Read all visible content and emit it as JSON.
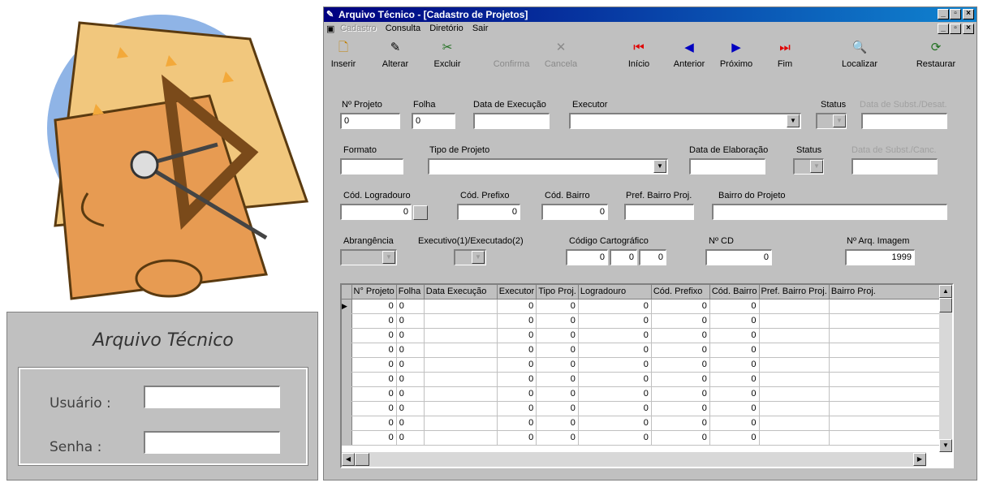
{
  "login": {
    "title": "Arquivo Técnico",
    "user_label": "Usuário :",
    "password_label": "Senha :",
    "user_value": "",
    "password_value": ""
  },
  "window": {
    "title": "Arquivo Técnico - [Cadastro de Projetos]",
    "controls": [
      "_",
      "▫",
      "×"
    ]
  },
  "menu": {
    "cadastro": "Cadastro",
    "consulta": "Consulta",
    "diretorio": "Diretório",
    "sair": "Sair"
  },
  "toolbar": {
    "inserir": "Inserir",
    "alterar": "Alterar",
    "excluir": "Excluir",
    "confirma": "Confirma",
    "cancela": "Cancela",
    "inicio": "Início",
    "anterior": "Anterior",
    "proximo": "Próximo",
    "fim": "Fim",
    "localizar": "Localizar",
    "restaurar": "Restaurar"
  },
  "form": {
    "n_projeto_label": "Nº Projeto",
    "n_projeto_value": "0",
    "folha_label": "Folha",
    "folha_value": "0",
    "data_execucao_label": "Data de Execução",
    "data_execucao_value": "",
    "executor_label": "Executor",
    "executor_value": "",
    "status1_label": "Status",
    "data_subst_desat_label": "Data de Subst./Desat.",
    "formato_label": "Formato",
    "formato_value": "",
    "tipo_projeto_label": "Tipo de Projeto",
    "tipo_projeto_value": "",
    "data_elaboracao_label": "Data de Elaboração",
    "data_elaboracao_value": "",
    "status2_label": "Status",
    "data_subst_canc_label": "Data de Subst./Canc.",
    "cod_logradouro_label": "Cód. Logradouro",
    "cod_logradouro_value": "0",
    "cod_prefixo_label": "Cód. Prefixo",
    "cod_prefixo_value": "0",
    "cod_bairro_label": "Cód. Bairro",
    "cod_bairro_value": "0",
    "pref_bairro_label": "Pref. Bairro Proj.",
    "pref_bairro_value": "",
    "bairro_projeto_label": "Bairro do Projeto",
    "bairro_projeto_value": "",
    "abrangencia_label": "Abrangência",
    "executivo_label": "Executivo(1)/Executado(2)",
    "codigo_cartografico_label": "Código Cartográfico",
    "cart1_value": "0",
    "cart2_value": "0",
    "cart3_value": "0",
    "n_cd_label": "Nº CD",
    "n_cd_value": "0",
    "n_arq_imagem_label": "Nº Arq. Imagem",
    "n_arq_imagem_value": "1999"
  },
  "grid": {
    "columns": [
      "N° Projeto",
      "Folha",
      "Data Execução",
      "Executor",
      "Tipo Proj.",
      "Logradouro",
      "Cód. Prefixo",
      "Cód. Bairro",
      "Pref. Bairro Proj.",
      "Bairro Proj."
    ],
    "rows": [
      [
        "0",
        "0",
        "",
        "0",
        "0",
        "0",
        "0",
        "0",
        "",
        ""
      ],
      [
        "0",
        "0",
        "",
        "0",
        "0",
        "0",
        "0",
        "0",
        "",
        ""
      ],
      [
        "0",
        "0",
        "",
        "0",
        "0",
        "0",
        "0",
        "0",
        "",
        ""
      ],
      [
        "0",
        "0",
        "",
        "0",
        "0",
        "0",
        "0",
        "0",
        "",
        ""
      ],
      [
        "0",
        "0",
        "",
        "0",
        "0",
        "0",
        "0",
        "0",
        "",
        ""
      ],
      [
        "0",
        "0",
        "",
        "0",
        "0",
        "0",
        "0",
        "0",
        "",
        ""
      ],
      [
        "0",
        "0",
        "",
        "0",
        "0",
        "0",
        "0",
        "0",
        "",
        ""
      ],
      [
        "0",
        "0",
        "",
        "0",
        "0",
        "0",
        "0",
        "0",
        "",
        ""
      ],
      [
        "0",
        "0",
        "",
        "0",
        "0",
        "0",
        "0",
        "0",
        "",
        ""
      ],
      [
        "0",
        "0",
        "",
        "0",
        "0",
        "0",
        "0",
        "0",
        "",
        ""
      ]
    ]
  }
}
